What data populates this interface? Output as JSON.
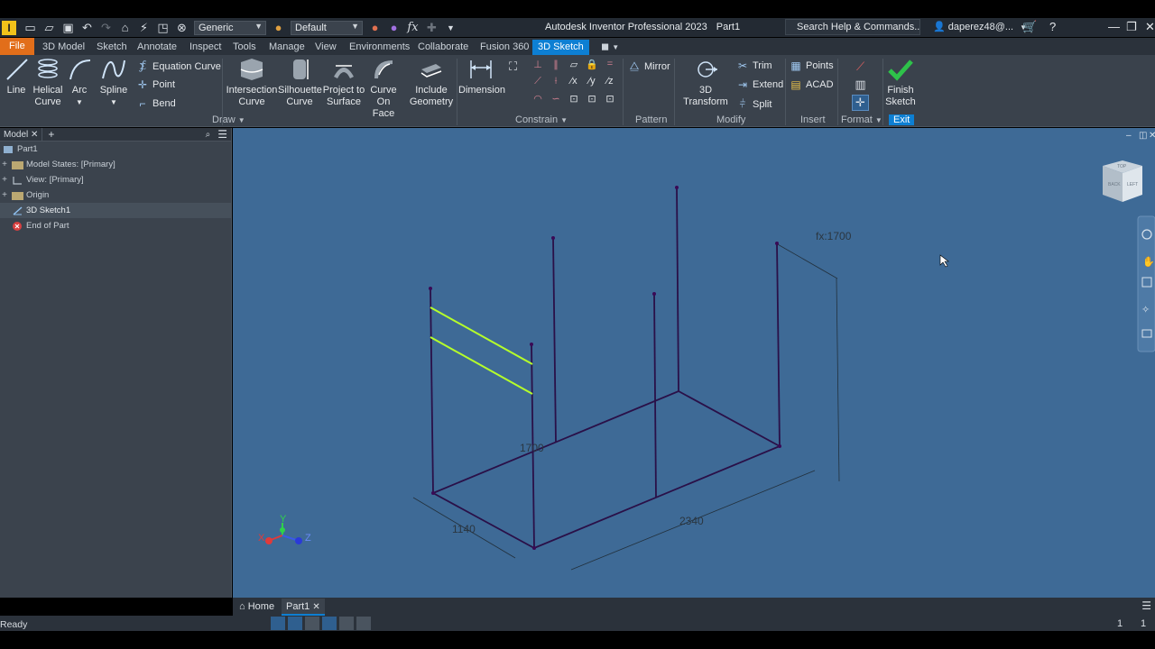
{
  "app": {
    "logo": "I",
    "title": "Autodesk Inventor Professional 2023",
    "doc": "Part1"
  },
  "qat": {
    "appearance": "Generic",
    "material": "Default",
    "formula": "fx"
  },
  "search": {
    "placeholder": "Search Help & Commands..."
  },
  "user": {
    "name": "daperez48@..."
  },
  "tabs": [
    {
      "label": "File"
    },
    {
      "label": "3D Model"
    },
    {
      "label": "Sketch"
    },
    {
      "label": "Annotate"
    },
    {
      "label": "Inspect"
    },
    {
      "label": "Tools"
    },
    {
      "label": "Manage"
    },
    {
      "label": "View"
    },
    {
      "label": "Environments"
    },
    {
      "label": "Collaborate"
    },
    {
      "label": "Fusion 360"
    },
    {
      "label": "3D Sketch"
    }
  ],
  "ribbon": {
    "draw": {
      "line": "Line",
      "helical1": "Helical",
      "helical2": "Curve",
      "arc": "Arc",
      "spline": "Spline",
      "equation_curve": "Equation Curve",
      "point": "Point",
      "bend": "Bend",
      "group": "Draw"
    },
    "geometry": {
      "intersection1": "Intersection",
      "intersection2": "Curve",
      "silhouette1": "Silhouette",
      "silhouette2": "Curve",
      "project1": "Project to",
      "project2": "Surface",
      "curveonface1": "Curve",
      "curveonface2": "On Face",
      "include1": "Include",
      "include2": "Geometry"
    },
    "constrain": {
      "dimension": "Dimension",
      "group": "Constrain"
    },
    "pattern": {
      "mirror": "Mirror",
      "group": "Pattern"
    },
    "modify": {
      "transform": "3D Transform",
      "trim": "Trim",
      "extend": "Extend",
      "split": "Split",
      "group": "Modify"
    },
    "insert": {
      "points": "Points",
      "acad": "ACAD",
      "group": "Insert"
    },
    "format": {
      "group": "Format"
    },
    "exit": {
      "finish1": "Finish",
      "finish2": "Sketch",
      "group": "Exit"
    }
  },
  "browser": {
    "tab": "Model",
    "items": [
      {
        "label": "Part1"
      },
      {
        "label": "Model States: [Primary]"
      },
      {
        "label": "View: [Primary]"
      },
      {
        "label": "Origin"
      },
      {
        "label": "3D Sketch1"
      },
      {
        "label": "End of Part"
      }
    ]
  },
  "viewport": {
    "dimensions": {
      "height_fx": "fx:1700",
      "height": "1700",
      "width": "1140",
      "length": "2340"
    },
    "triad": {
      "x": "X",
      "y": "Y",
      "z": "Z"
    },
    "viewcube": {
      "face1": "BACK",
      "face2": "LEFT",
      "face3": "TOP"
    }
  },
  "doc_tabs": {
    "home": "Home",
    "part": "Part1"
  },
  "status": {
    "text": "Ready",
    "count1": "1",
    "count2": "1"
  },
  "colors": {
    "accent": "#0d7fd3",
    "file_tab": "#e26e1a",
    "viewport_bg": "#3e6a96",
    "sketch_line": "#2a1048",
    "highlight": "#b6ff2a"
  }
}
